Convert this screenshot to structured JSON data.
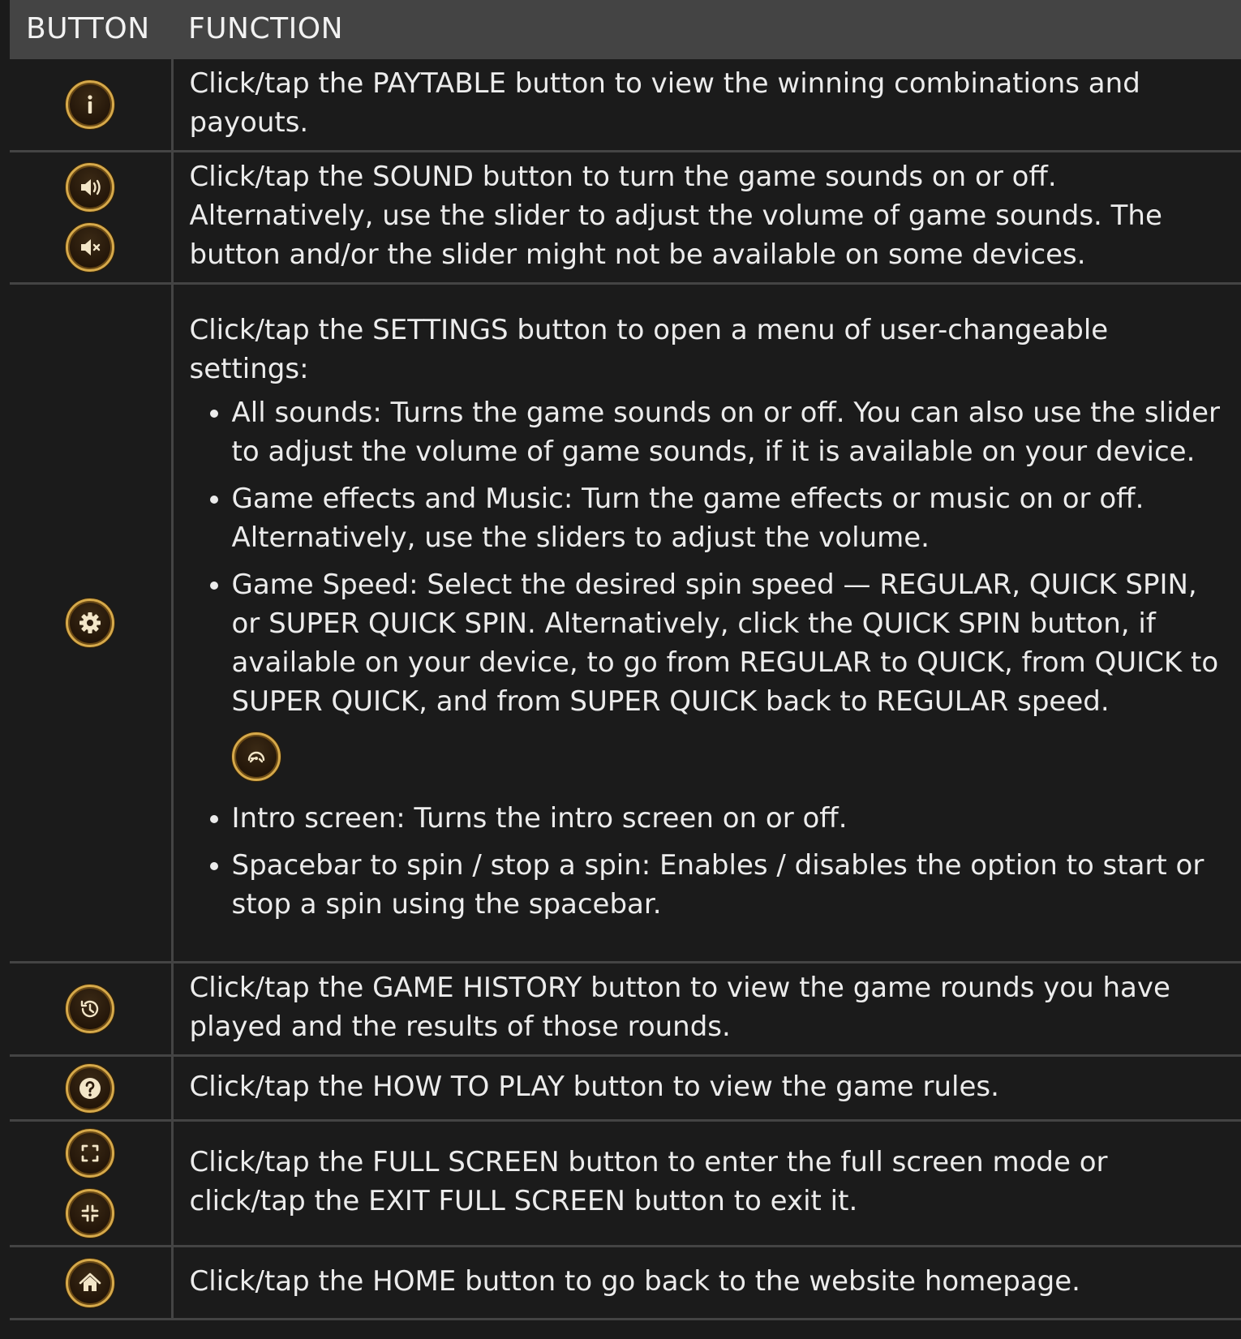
{
  "header": {
    "col_button": "BUTTON",
    "col_function": "FUNCTION"
  },
  "rows": {
    "paytable": {
      "icon": "info-icon",
      "text": "Click/tap the PAYTABLE button to view the winning combinations and payouts."
    },
    "sound": {
      "icons": [
        "sound-on-icon",
        "sound-off-icon"
      ],
      "text": "Click/tap the SOUND button to turn the game sounds on or off. Alternatively, use the slider to adjust the volume of game sounds. The button and/or the slider might not be available on some devices."
    },
    "settings": {
      "icon": "gear-icon",
      "intro": "Click/tap the SETTINGS button to open a menu of user-changeable settings:",
      "items": [
        "All sounds: Turns the game sounds on or off. You can also use the slider to adjust the volume of game sounds, if it is available on your device.",
        "Game effects and Music: Turn the game effects or music on or off. Alternatively, use the sliders to adjust the volume.",
        "Game Speed: Select the desired spin speed — REGULAR, QUICK SPIN, or SUPER QUICK SPIN. Alternatively, click the QUICK SPIN button, if available on your device, to go from REGULAR to QUICK, from QUICK to SUPER QUICK, and from SUPER QUICK back to REGULAR speed.",
        "Intro screen: Turns the intro screen on or off.",
        "Spacebar to spin / stop a spin: Enables / disables the option to start or stop a spin using the spacebar."
      ],
      "quick_spin_icon": "speedometer-icon"
    },
    "history": {
      "icon": "history-icon",
      "text": "Click/tap the GAME HISTORY button to view the game rounds you have played and the results of those rounds."
    },
    "howtoplay": {
      "icon": "question-icon",
      "text": "Click/tap the HOW TO PLAY button to view the game rules."
    },
    "fullscreen": {
      "icons": [
        "fullscreen-enter-icon",
        "fullscreen-exit-icon"
      ],
      "text": "Click/tap the FULL SCREEN button to enter the full screen mode or click/tap the EXIT FULL SCREEN button to exit it."
    },
    "home": {
      "icon": "home-icon",
      "text": "Click/tap the HOME button to go back to the website homepage."
    }
  },
  "colors": {
    "header_bg": "#444444",
    "page_bg": "#1b1b1b",
    "icon_ring": "#d6a94a",
    "text": "#ececec"
  }
}
